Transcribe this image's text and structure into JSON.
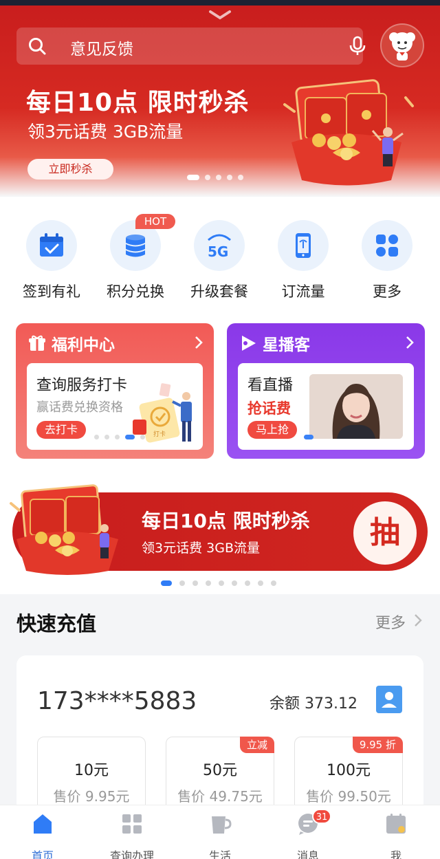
{
  "search": {
    "placeholder": "意见反馈"
  },
  "hero": {
    "title": "每日10点 限时秒杀",
    "subtitle": "领3元话费 3GB流量",
    "button": "立即秒杀",
    "carousel_pages": 5,
    "active_page": 1
  },
  "quick_actions": [
    {
      "label": "签到有礼",
      "icon": "calendar-check-icon"
    },
    {
      "label": "积分兑换",
      "icon": "coin-stack-icon",
      "badge": "HOT"
    },
    {
      "label": "升级套餐",
      "icon": "5g-icon"
    },
    {
      "label": "订流量",
      "icon": "phone-signal-icon"
    },
    {
      "label": "更多",
      "icon": "grid-more-icon"
    }
  ],
  "cards": {
    "welfare": {
      "title": "福利中心",
      "item_title": "查询服务打卡",
      "item_sub": "赢话费兑换资格",
      "button": "去打卡",
      "illustration_tag": "打卡"
    },
    "star": {
      "title": "星播客",
      "item_title": "看直播",
      "item_sub": "抢话费",
      "button": "马上抢"
    }
  },
  "banner2": {
    "title": "每日10点 限时秒杀",
    "subtitle": "领3元话费 3GB流量",
    "action": "抽",
    "carousel_pages": 9,
    "active_page": 1
  },
  "recharge": {
    "title": "快速充值",
    "more": "更多",
    "phone": "173****5883",
    "balance_label": "余额 373.12",
    "options": [
      {
        "amount": "10元",
        "price": "售价 9.95元",
        "tag": ""
      },
      {
        "amount": "50元",
        "price": "售价 49.75元",
        "tag": "立减"
      },
      {
        "amount": "100元",
        "price": "售价 99.50元",
        "tag": "9.95 折"
      }
    ]
  },
  "tabs": [
    {
      "label": "首页",
      "icon": "home-icon",
      "active": true
    },
    {
      "label": "查询办理",
      "icon": "apps-icon",
      "active": false
    },
    {
      "label": "生活",
      "icon": "cup-icon",
      "active": false
    },
    {
      "label": "消息",
      "icon": "message-icon",
      "active": false,
      "badge": "31"
    },
    {
      "label": "我",
      "icon": "profile-icon",
      "active": false
    }
  ],
  "colors": {
    "brand_red": "#c81d1d",
    "accent_blue": "#2f6fd6",
    "purple": "#8a38e8"
  }
}
